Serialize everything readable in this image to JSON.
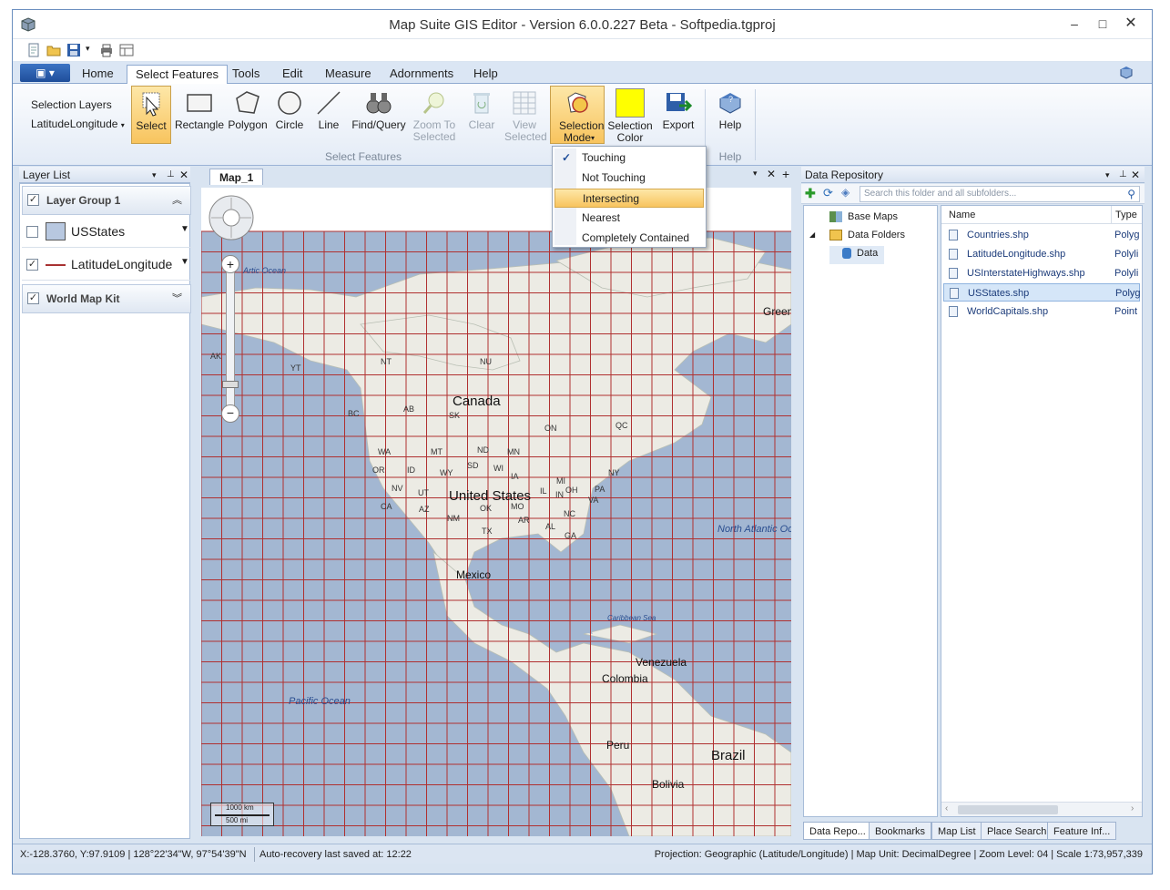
{
  "window": {
    "title": "Map Suite GIS Editor - Version 6.0.0.227 Beta - Softpedia.tgproj"
  },
  "ribbon_tabs": [
    "Home",
    "Select Features",
    "Tools",
    "Edit",
    "Measure",
    "Adornments",
    "Help"
  ],
  "ribbon": {
    "selection_layers_label": "Selection Layers",
    "selection_layer_value": "LatitudeLongitude",
    "buttons": [
      {
        "label": "Select",
        "state": "active"
      },
      {
        "label": "Rectangle"
      },
      {
        "label": "Polygon"
      },
      {
        "label": "Circle"
      },
      {
        "label": "Line"
      },
      {
        "label": "Find/Query"
      },
      {
        "label": "Zoom To Selected",
        "state": "disabled"
      },
      {
        "label": "Clear",
        "state": "disabled"
      },
      {
        "label": "View Selected",
        "state": "disabled"
      },
      {
        "label": "Selection Mode",
        "state": "pressed"
      },
      {
        "label": "Selection Color"
      },
      {
        "label": "Export"
      }
    ],
    "help_button": "Help",
    "group_select_features": "Select Features",
    "group_help": "Help",
    "selection_color": "#ffff00"
  },
  "selection_mode_menu": {
    "items": [
      "Touching",
      "Not Touching",
      "Intersecting",
      "Nearest",
      "Completely Contained"
    ],
    "checked": "Touching",
    "highlighted": "Intersecting"
  },
  "layer_list": {
    "title": "Layer List",
    "groups": [
      {
        "name": "Layer Group 1",
        "checked": true,
        "layers": [
          {
            "name": "USStates",
            "checked": false
          },
          {
            "name": "LatitudeLongitude",
            "checked": true
          }
        ]
      },
      {
        "name": "World Map Kit",
        "checked": true,
        "layers": []
      }
    ]
  },
  "map": {
    "tab": "Map_1",
    "labels": {
      "canada": "Canada",
      "united_states": "United States",
      "mexico": "Mexico",
      "venezuela": "Venezuela",
      "colombia": "Colombia",
      "peru": "Peru",
      "brazil": "Brazil",
      "bolivia": "Bolivia",
      "green": "Green",
      "arctic": "Artic Ocean",
      "pacific": "Pacific Ocean",
      "north_atlantic": "North Atlantic Oc",
      "caribbean": "Caribbean Sea",
      "states": [
        "AK",
        "YT",
        "NT",
        "NU",
        "BC",
        "AB",
        "SK",
        "ON",
        "QC",
        "WA",
        "MT",
        "ND",
        "MN",
        "OR",
        "ID",
        "WY",
        "IA",
        "NY",
        "NV",
        "UT",
        "IL",
        "IN",
        "OH",
        "PA",
        "CA",
        "AZ",
        "NM",
        "MO",
        "VA",
        "OK",
        "AR",
        "TX",
        "AL",
        "GA",
        "NC",
        "SD",
        "WI",
        "MI"
      ]
    },
    "scale_km": "1000 km",
    "scale_mi": "500 mi"
  },
  "data_repository": {
    "title": "Data Repository",
    "search_placeholder": "Search this folder and all subfolders...",
    "tree": [
      "Base Maps",
      "Data Folders",
      "Data"
    ],
    "columns": [
      "Name",
      "Type"
    ],
    "files": [
      {
        "name": "Countries.shp",
        "type": "Polyg"
      },
      {
        "name": "LatitudeLongitude.shp",
        "type": "Polyli"
      },
      {
        "name": "USInterstateHighways.shp",
        "type": "Polyli"
      },
      {
        "name": "USStates.shp",
        "type": "Polyg",
        "selected": true
      },
      {
        "name": "WorldCapitals.shp",
        "type": "Point"
      }
    ],
    "bottom_tabs": [
      "Data Repo...",
      "Bookmarks",
      "Map List",
      "Place Search",
      "Feature Inf..."
    ]
  },
  "status": {
    "coords": "X:-128.3760, Y:97.9109 | 128°22'34\"W, 97°54'39\"N",
    "autosave": "Auto-recovery last saved at: 12:22",
    "projection": "Projection: Geographic (Latitude/Longitude) | Map Unit: DecimalDegree | Zoom Level: 04 | Scale 1:73,957,339"
  }
}
